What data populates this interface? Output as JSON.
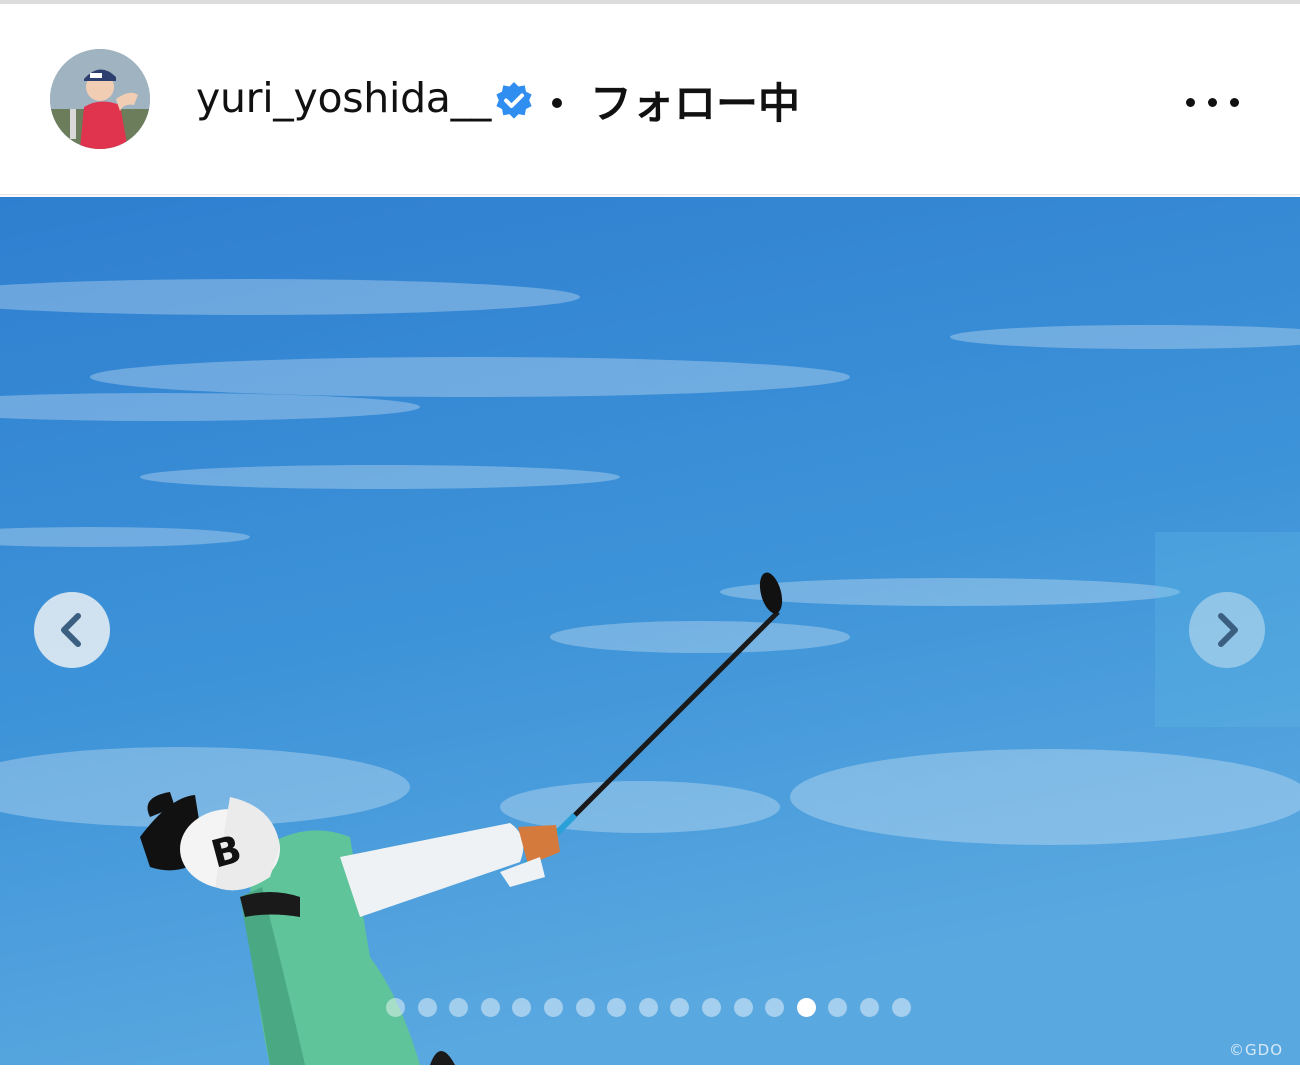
{
  "post_header": {
    "username": "yuri_yoshida__",
    "verified_icon": "verified-badge-icon",
    "separator": "•",
    "follow_status": "フォロー中",
    "more_icon": "more-options-icon"
  },
  "colors": {
    "verified": "#2f8ef0",
    "sky_top": "#2f7fd0",
    "sky_bottom": "#5aa8e0",
    "shirt": "#5fc49a"
  },
  "carousel": {
    "prev_icon": "chevron-left-icon",
    "next_icon": "chevron-right-icon",
    "total_slides": 17,
    "active_index": 13,
    "credit": "©GDO"
  }
}
